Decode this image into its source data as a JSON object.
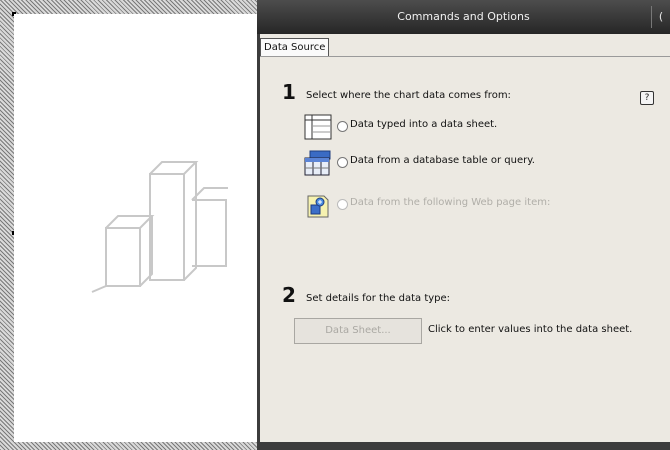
{
  "window": {
    "title": "Commands and Options",
    "title_button": "("
  },
  "tabs": [
    {
      "label": "Data Source"
    }
  ],
  "help_symbol": "?",
  "step1": {
    "number": "1",
    "text": "Select where the chart data comes from:",
    "options": [
      {
        "label": "Data typed into a data sheet.",
        "icon": "datasheet-icon",
        "enabled": true,
        "selected": false
      },
      {
        "label": "Data from a database table or query.",
        "icon": "database-icon",
        "enabled": true,
        "selected": false
      },
      {
        "label": "Data from the following Web page item:",
        "icon": "webpage-item-icon",
        "enabled": false,
        "selected": false
      }
    ]
  },
  "step2": {
    "number": "2",
    "text": "Set details for the data type:",
    "button_label": "Data Sheet...",
    "button_help": "Click to enter values into the data sheet."
  },
  "colors": {
    "titlebar": "#2e2e2e",
    "panel_bg": "#ece9e2",
    "chart_placeholder": "#c8c8c8"
  }
}
